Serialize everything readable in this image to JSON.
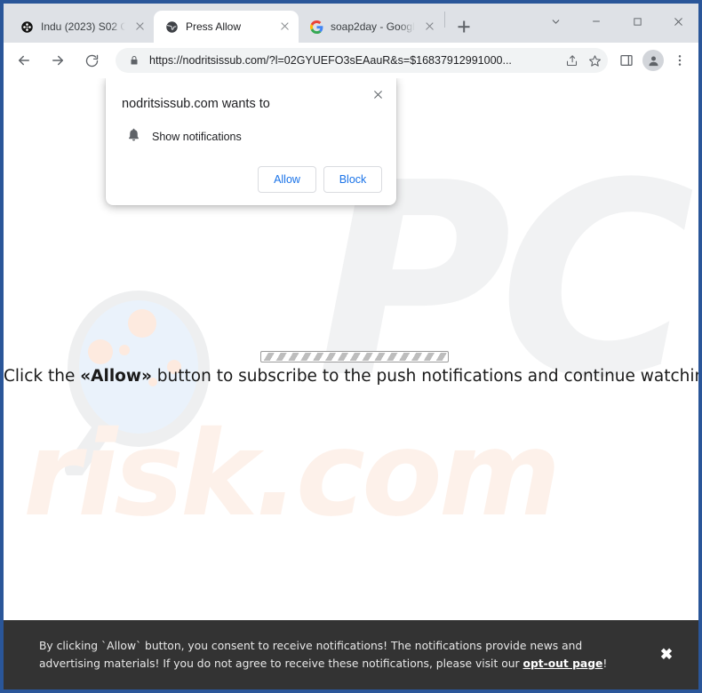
{
  "window": {
    "controls": [
      {
        "name": "tab-search",
        "glyph": "chevron-down"
      },
      {
        "name": "minimize",
        "glyph": "minimize"
      },
      {
        "name": "maximize",
        "glyph": "maximize"
      },
      {
        "name": "close",
        "glyph": "close"
      }
    ]
  },
  "tabs": [
    {
      "title": "Indu (2023) S02 Co",
      "favicon": "film-reel-icon",
      "active": false
    },
    {
      "title": "Press Allow",
      "favicon": "globe-icon",
      "active": true
    },
    {
      "title": "soap2day - Google",
      "favicon": "google-icon",
      "active": false
    }
  ],
  "newtab_label": "New tab",
  "toolbar": {
    "back_label": "Back",
    "forward_label": "Forward",
    "reload_label": "Reload",
    "url": "https://nodritsissub.com/?l=02GYUEFO3sEAauR&s=$16837912991000...",
    "lock_icon": "lock-icon",
    "share_icon": "share-icon",
    "bookmark_icon": "star-icon",
    "sidepanel_icon": "side-panel-icon",
    "profile_icon": "avatar-icon",
    "menu_icon": "three-dot-menu-icon"
  },
  "permission_dialog": {
    "title": "nodritsissub.com wants to",
    "permission_icon": "bell-icon",
    "permission_label": "Show notifications",
    "allow_label": "Allow",
    "block_label": "Block",
    "close_label": "Close"
  },
  "page": {
    "cta_prefix": "Click the ",
    "cta_allow": "«Allow»",
    "cta_suffix": " button to subscribe to the push notifications and continue watching",
    "watermark_pc": "PC",
    "watermark_risk": "risk.com",
    "progress_label": "loading"
  },
  "consent_banner": {
    "line1": "By clicking `Allow` button, you consent to receive notifications! The notifications provide news and advertising materials! If",
    "line2_before": "you do not agree to receive these notifications, please visit our ",
    "link_label": "opt-out page",
    "line2_after": "!",
    "close_label": "✖"
  },
  "colors": {
    "chrome_bg": "#dee1e6",
    "accent_blue": "#1a73e8",
    "frame_border": "#2a5699",
    "banner_bg": "#333333",
    "watermark_gray": "#f1f2f3",
    "watermark_peach": "#fdf1ea"
  }
}
